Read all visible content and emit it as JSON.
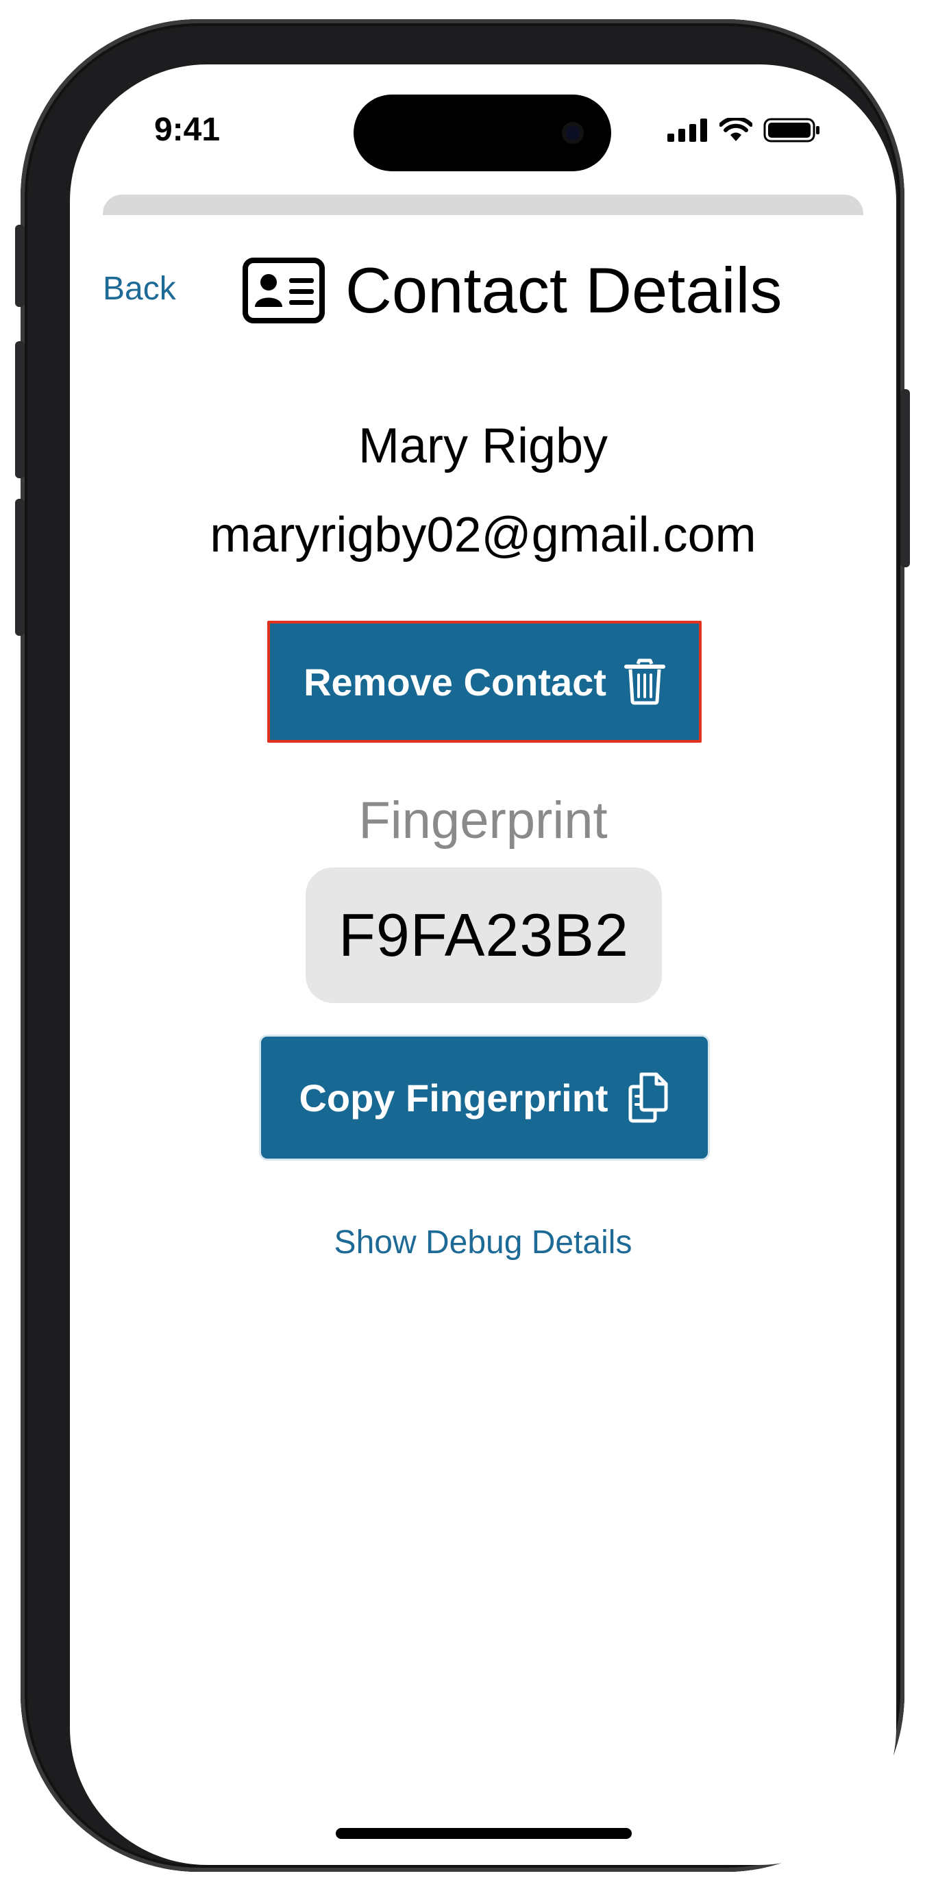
{
  "status_bar": {
    "time": "9:41",
    "icons": [
      "signal-icon",
      "wifi-icon",
      "battery-icon"
    ]
  },
  "nav": {
    "back_label": "Back",
    "title": "Contact Details",
    "title_icon": "contact-card-icon"
  },
  "contact": {
    "name": "Mary Rigby",
    "email": "maryrigby02@gmail.com"
  },
  "actions": {
    "remove_label": "Remove Contact",
    "remove_icon": "trash-icon",
    "copy_label": "Copy Fingerprint",
    "copy_icon": "copy-icon",
    "debug_label": "Show Debug Details"
  },
  "fingerprint": {
    "label": "Fingerprint",
    "value": "F9FA23B2"
  },
  "colors": {
    "accent": "#176993",
    "link": "#1e6a96",
    "highlight_border": "#e0321e",
    "fingerprint_bg": "#e6e6e6"
  }
}
